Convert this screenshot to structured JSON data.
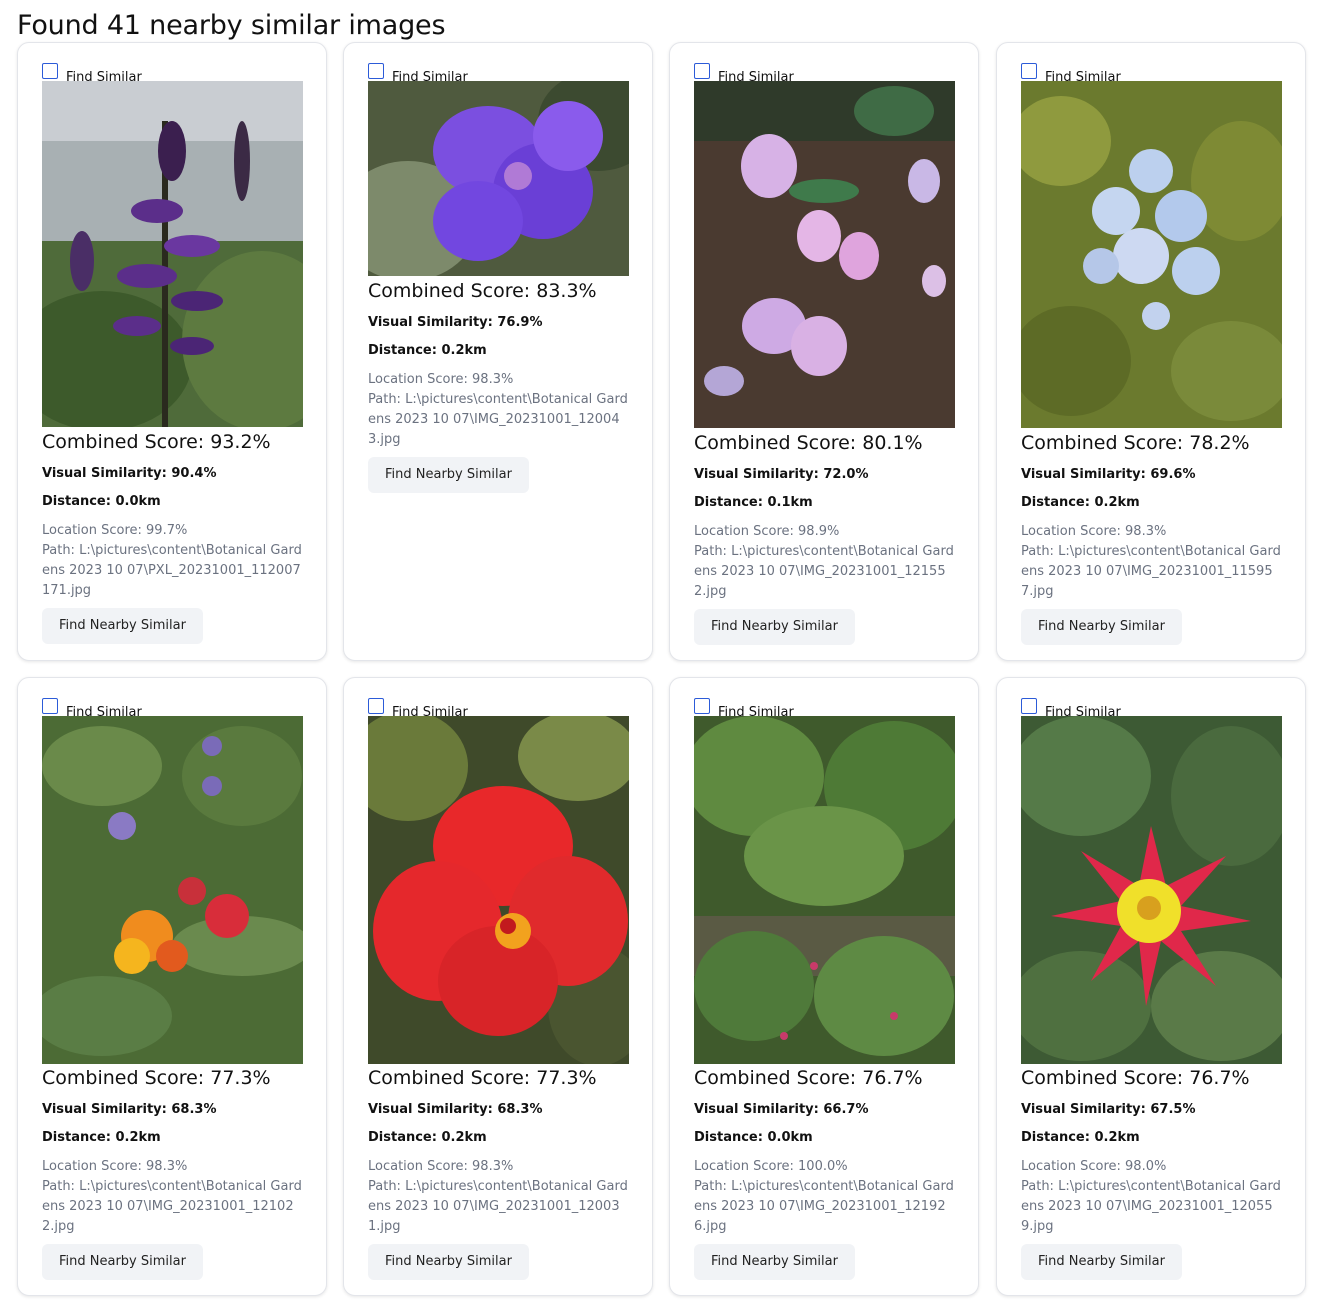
{
  "heading": "Found 41 nearby similar images",
  "labels": {
    "find_similar": "Find Similar",
    "find_nearby": "Find Nearby Similar"
  },
  "cards": [
    {
      "image": "purple-salvia-flower",
      "combined": "Combined Score: 93.2%",
      "visual": "Visual Similarity: 90.4%",
      "distance": "Distance: 0.0km",
      "location": "Location Score: 99.7%",
      "path": "Path: L:\\pictures\\content\\Botanical Gardens 2023 10 07\\PXL_20231001_112007171.jpg"
    },
    {
      "image": "purple-tibouchina-flower",
      "combined": "Combined Score: 83.3%",
      "visual": "Visual Similarity: 76.9%",
      "distance": "Distance: 0.2km",
      "location": "Location Score: 98.3%",
      "path": "Path: L:\\pictures\\content\\Botanical Gardens 2023 10 07\\IMG_20231001_120043.jpg"
    },
    {
      "image": "pink-cyclamen-flowers",
      "combined": "Combined Score: 80.1%",
      "visual": "Visual Similarity: 72.0%",
      "distance": "Distance: 0.1km",
      "location": "Location Score: 98.9%",
      "path": "Path: L:\\pictures\\content\\Botanical Gardens 2023 10 07\\IMG_20231001_121552.jpg"
    },
    {
      "image": "blue-plumbago-flowers",
      "combined": "Combined Score: 78.2%",
      "visual": "Visual Similarity: 69.6%",
      "distance": "Distance: 0.2km",
      "location": "Location Score: 98.3%",
      "path": "Path: L:\\pictures\\content\\Botanical Gardens 2023 10 07\\IMG_20231001_115957.jpg"
    },
    {
      "image": "orange-milkweed-flowers",
      "combined": "Combined Score: 77.3%",
      "visual": "Visual Similarity: 68.3%",
      "distance": "Distance: 0.2km",
      "location": "Location Score: 98.3%",
      "path": "Path: L:\\pictures\\content\\Botanical Gardens 2023 10 07\\IMG_20231001_121022.jpg"
    },
    {
      "image": "red-hibiscus-flower",
      "combined": "Combined Score: 77.3%",
      "visual": "Visual Similarity: 68.3%",
      "distance": "Distance: 0.2km",
      "location": "Location Score: 98.3%",
      "path": "Path: L:\\pictures\\content\\Botanical Gardens 2023 10 07\\IMG_20231001_120031.jpg"
    },
    {
      "image": "green-foliage-ground",
      "combined": "Combined Score: 76.7%",
      "visual": "Visual Similarity: 66.7%",
      "distance": "Distance: 0.0km",
      "location": "Location Score: 100.0%",
      "path": "Path: L:\\pictures\\content\\Botanical Gardens 2023 10 07\\IMG_20231001_121926.jpg"
    },
    {
      "image": "red-yellow-dahlia-flower",
      "combined": "Combined Score: 76.7%",
      "visual": "Visual Similarity: 67.5%",
      "distance": "Distance: 0.2km",
      "location": "Location Score: 98.0%",
      "path": "Path: L:\\pictures\\content\\Botanical Gardens 2023 10 07\\IMG_20231001_120559.jpg"
    }
  ]
}
